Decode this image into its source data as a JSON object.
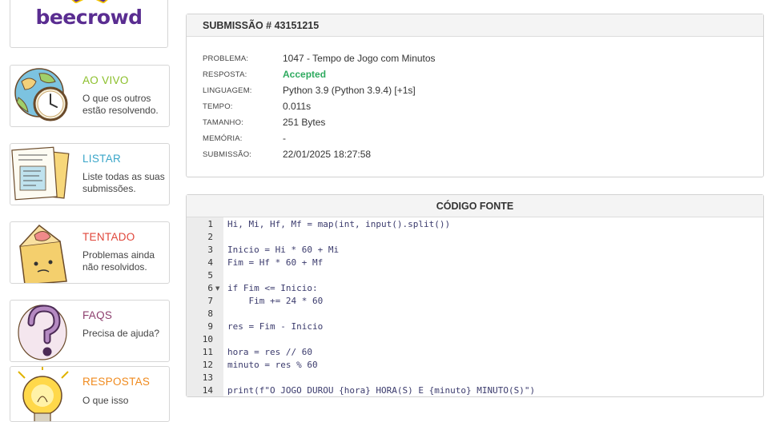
{
  "logo": {
    "text": "beecrowd"
  },
  "menu": [
    {
      "title": "AO VIVO",
      "desc": "O que os outros estão resolvendo.",
      "color": "#8bbf2a",
      "icon": "globe-clock-icon"
    },
    {
      "title": "LISTAR",
      "desc": "Liste todas as suas submissões.",
      "color": "#3aa6c9",
      "icon": "documents-icon"
    },
    {
      "title": "TENTADO",
      "desc": "Problemas ainda não resolvidos.",
      "color": "#e0463a",
      "icon": "crumpled-box-icon"
    },
    {
      "title": "FAQS",
      "desc": "Precisa de ajuda?",
      "color": "#8d3f6e",
      "icon": "question-mark-icon"
    },
    {
      "title": "RESPOSTAS",
      "desc": "O que isso",
      "color": "#f08a1d",
      "icon": "lightbulb-icon"
    }
  ],
  "submission": {
    "title": "SUBMISSÃO # 43151215",
    "rows": [
      {
        "label": "PROBLEMA:",
        "value": "1047 - Tempo de Jogo com Minutos"
      },
      {
        "label": "RESPOSTA:",
        "value": "Accepted"
      },
      {
        "label": "LINGUAGEM:",
        "value": "Python 3.9 (Python 3.9.4) [+1s]"
      },
      {
        "label": "TEMPO:",
        "value": "0.011s"
      },
      {
        "label": "TAMANHO:",
        "value": "251 Bytes"
      },
      {
        "label": "MEMÓRIA:",
        "value": "-"
      },
      {
        "label": "SUBMISSÃO:",
        "value": "22/01/2025 18:27:58"
      }
    ]
  },
  "source": {
    "title": "CÓDIGO FONTE",
    "lines": [
      {
        "n": "1",
        "code": "Hi, Mi, Hf, Mf = map(int, input().split())"
      },
      {
        "n": "2",
        "code": ""
      },
      {
        "n": "3",
        "code": "Inicio = Hi * 60 + Mi"
      },
      {
        "n": "4",
        "code": "Fim = Hf * 60 + Mf"
      },
      {
        "n": "5",
        "code": ""
      },
      {
        "n": "6",
        "code": "if Fim <= Inicio:"
      },
      {
        "n": "7",
        "code": "    Fim += 24 * 60"
      },
      {
        "n": "8",
        "code": ""
      },
      {
        "n": "9",
        "code": "res = Fim - Inicio"
      },
      {
        "n": "10",
        "code": ""
      },
      {
        "n": "11",
        "code": "hora = res // 60"
      },
      {
        "n": "12",
        "code": "minuto = res % 60"
      },
      {
        "n": "13",
        "code": ""
      },
      {
        "n": "14",
        "code": "print(f\"O JOGO DUROU {hora} HORA(S) E {minuto} MINUTO(S)\")"
      }
    ]
  }
}
